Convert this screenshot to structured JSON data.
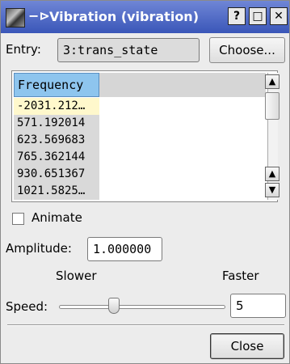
{
  "window": {
    "title": "Vibration (vibration)",
    "pin_glyph": "−⊳",
    "help_label": "?",
    "maximize_label": "□",
    "close_label": "✕"
  },
  "entry": {
    "label": "Entry:",
    "value": "3:trans_state",
    "choose_label": "Choose..."
  },
  "frequency_list": {
    "header": "Frequency",
    "rows": [
      "-2031.212…",
      "571.192014",
      "623.569683",
      "765.362144",
      "930.651367",
      "1021.5825…"
    ],
    "selected_index": 0,
    "scroll_up": "▲",
    "scroll_down": "▼"
  },
  "animate": {
    "label": "Animate",
    "checked": false
  },
  "amplitude": {
    "label": "Amplitude:",
    "value": "1.000000"
  },
  "speed": {
    "slower_label": "Slower",
    "faster_label": "Faster",
    "label": "Speed:",
    "value": "5",
    "slider_fraction": 0.32
  },
  "footer": {
    "close_label": "Close"
  },
  "colors": {
    "title_bar": "#3a56b8",
    "header_highlight": "#8ec5ee",
    "selected_row": "#fff8cc"
  }
}
